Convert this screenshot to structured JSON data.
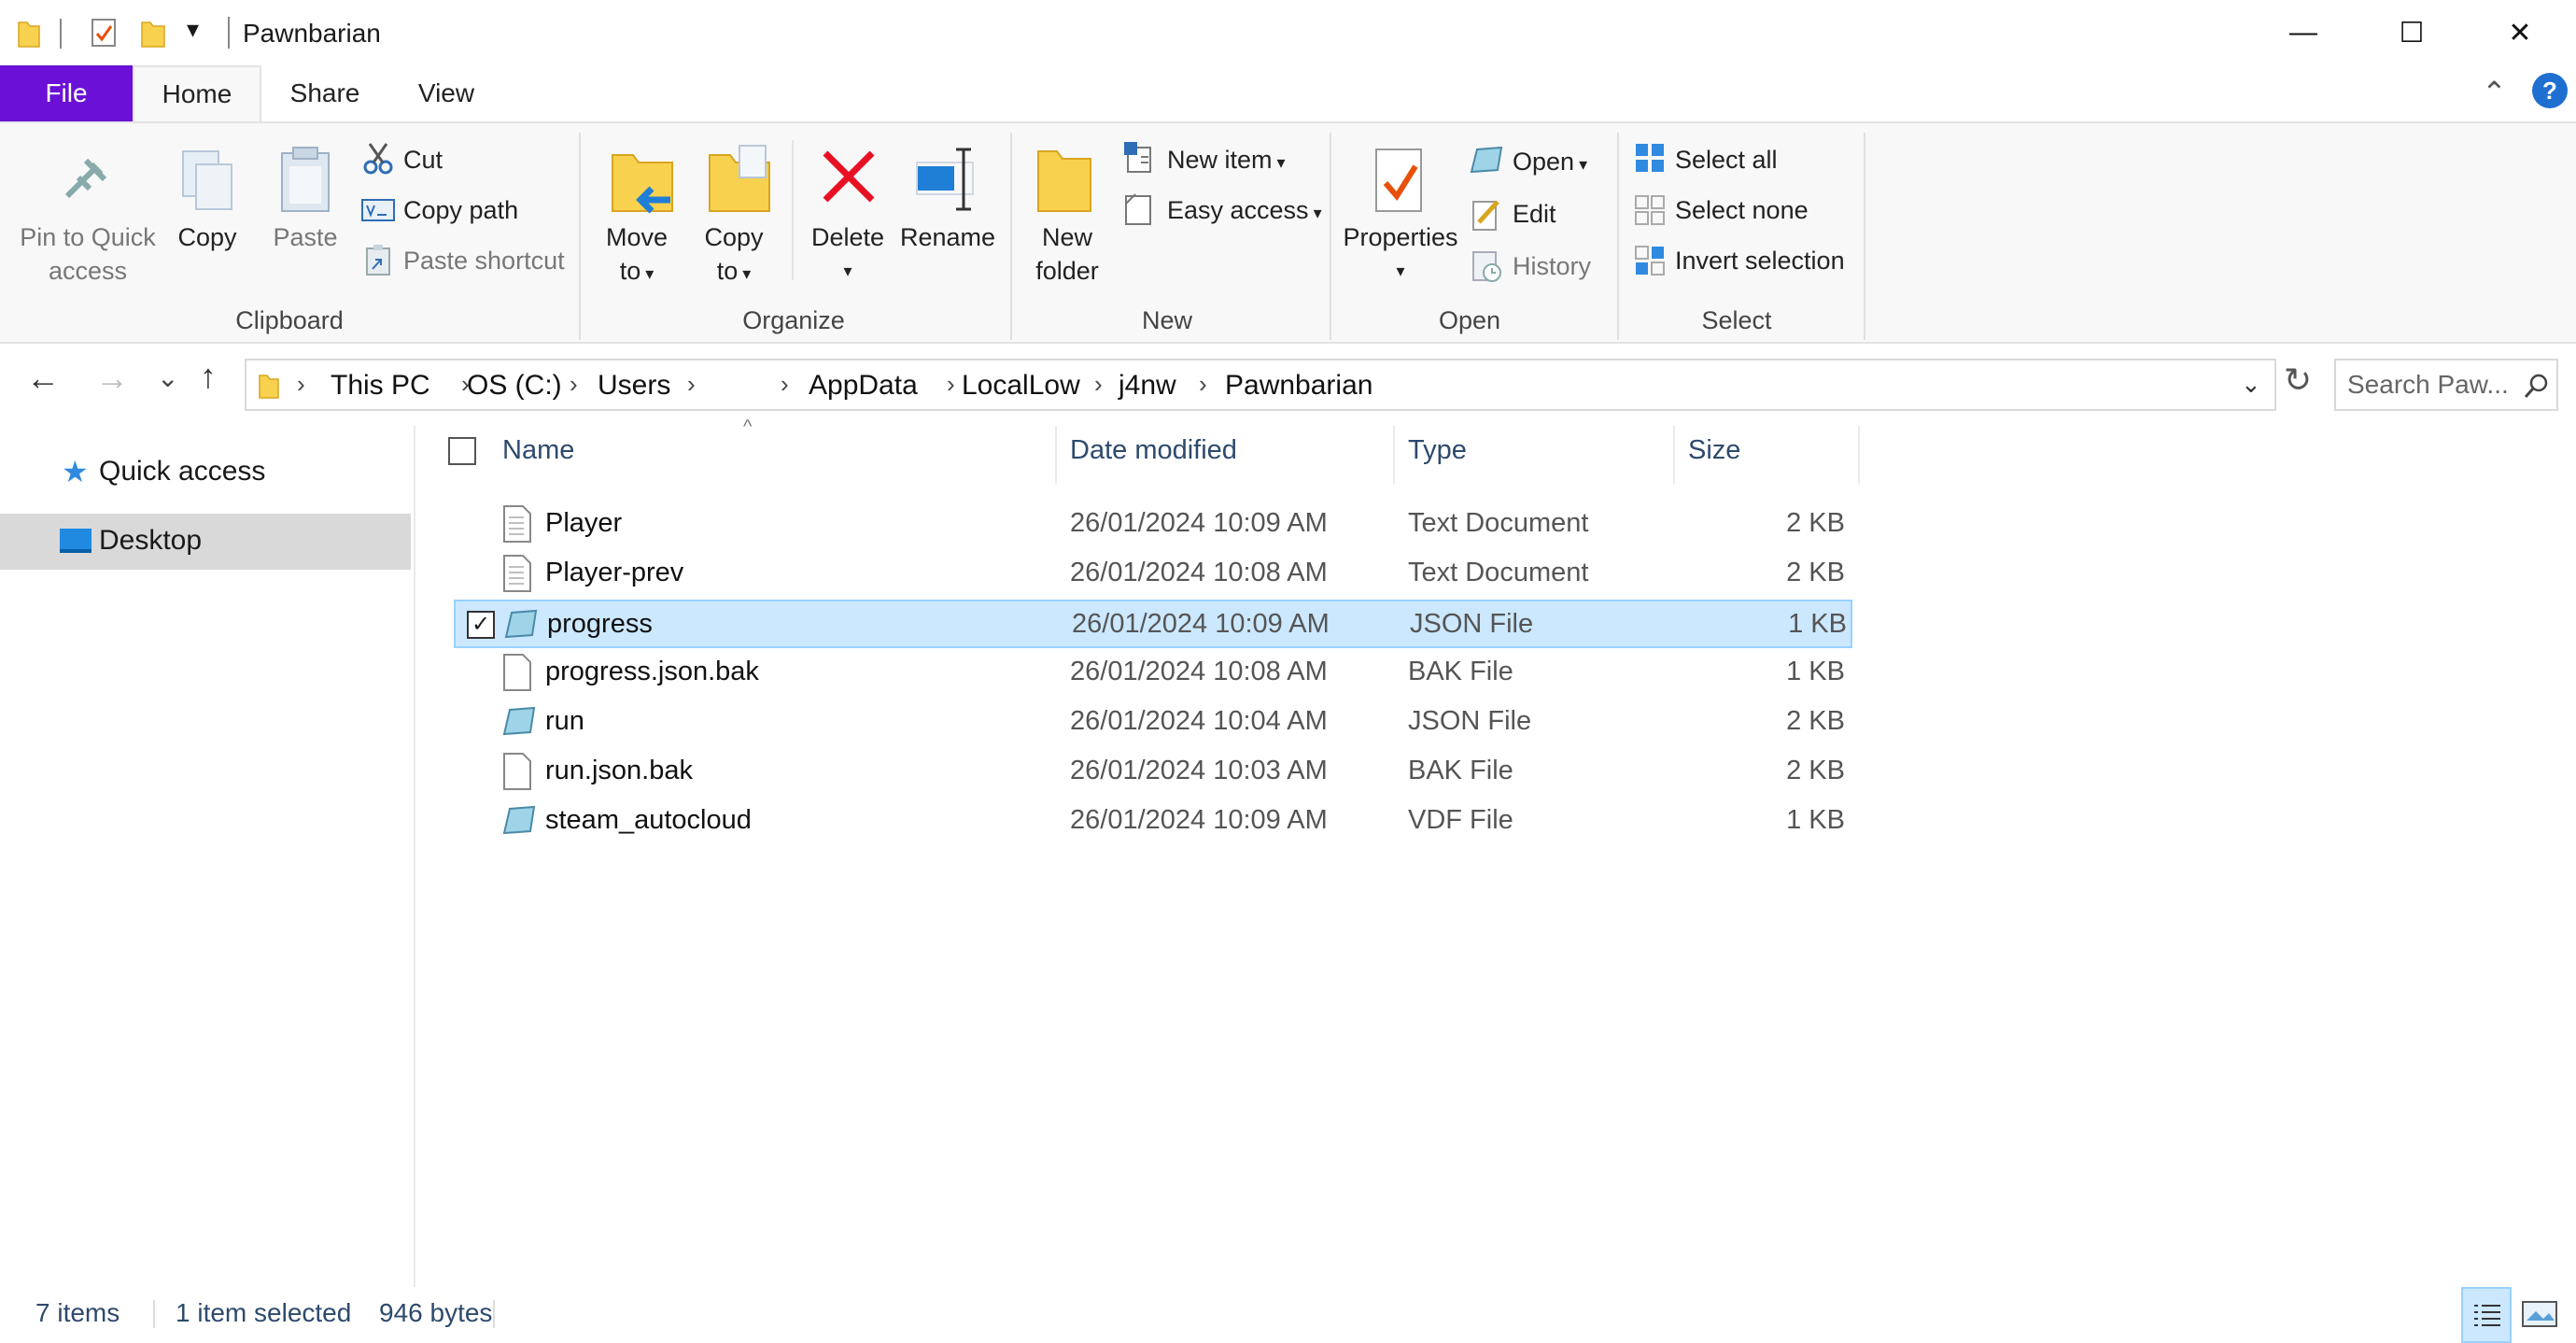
{
  "window": {
    "title": "Pawnbarian",
    "minimize_glyph": "—",
    "maximize_glyph": "☐",
    "close_glyph": "✕"
  },
  "ribbon_tabs": [
    "File",
    "Home",
    "Share",
    "View"
  ],
  "help_glyph": "?",
  "ribbon": {
    "clipboard": {
      "label": "Clipboard",
      "pin": "Pin to Quick access",
      "pin_l1": "Pin to Quick",
      "pin_l2": "access",
      "copy": "Copy",
      "paste": "Paste",
      "cut": "Cut",
      "copy_path": "Copy path",
      "paste_shortcut": "Paste shortcut"
    },
    "organize": {
      "label": "Organize",
      "move_l1": "Move",
      "move_l2": "to",
      "copy_l1": "Copy",
      "copy_l2": "to",
      "delete": "Delete",
      "rename": "Rename"
    },
    "new": {
      "label": "New",
      "folder_l1": "New",
      "folder_l2": "folder",
      "new_item": "New item",
      "easy_access": "Easy access"
    },
    "open": {
      "label": "Open",
      "properties": "Properties",
      "open": "Open",
      "edit": "Edit",
      "history": "History"
    },
    "select": {
      "label": "Select",
      "select_all": "Select all",
      "select_none": "Select none",
      "invert": "Invert selection"
    }
  },
  "address": {
    "crumbs": [
      "This PC",
      "OS (C:)",
      "Users",
      "",
      "AppData",
      "LocalLow",
      "j4nw",
      "Pawnbarian"
    ],
    "search_placeholder": "Search Paw..."
  },
  "nav": {
    "items": [
      {
        "label": "Quick access",
        "icon": "star-icon"
      },
      {
        "label": "Desktop",
        "icon": "desktop-icon",
        "selected": true
      }
    ]
  },
  "columns": [
    "Name",
    "Date modified",
    "Type",
    "Size"
  ],
  "files": [
    {
      "name": "Player",
      "date": "26/01/2024 10:09 AM",
      "type": "Text Document",
      "size": "2 KB",
      "icon": "text-file-icon",
      "selected": false
    },
    {
      "name": "Player-prev",
      "date": "26/01/2024 10:08 AM",
      "type": "Text Document",
      "size": "2 KB",
      "icon": "text-file-icon",
      "selected": false
    },
    {
      "name": "progress",
      "date": "26/01/2024 10:09 AM",
      "type": "JSON File",
      "size": "1 KB",
      "icon": "json-file-icon",
      "selected": true
    },
    {
      "name": "progress.json.bak",
      "date": "26/01/2024 10:08 AM",
      "type": "BAK File",
      "size": "1 KB",
      "icon": "blank-file-icon",
      "selected": false
    },
    {
      "name": "run",
      "date": "26/01/2024 10:04 AM",
      "type": "JSON File",
      "size": "2 KB",
      "icon": "json-file-icon",
      "selected": false
    },
    {
      "name": "run.json.bak",
      "date": "26/01/2024 10:03 AM",
      "type": "BAK File",
      "size": "2 KB",
      "icon": "blank-file-icon",
      "selected": false
    },
    {
      "name": "steam_autocloud",
      "date": "26/01/2024 10:09 AM",
      "type": "VDF File",
      "size": "1 KB",
      "icon": "vdf-file-icon",
      "selected": false
    }
  ],
  "status": {
    "count": "7 items",
    "selection": "1 item selected",
    "size": "946 bytes"
  },
  "colors": {
    "accent": "#6b10d6",
    "selection": "#cce8ff",
    "selection_border": "#99d1ff",
    "folder": "#f8d14f",
    "delete": "#e81123"
  }
}
